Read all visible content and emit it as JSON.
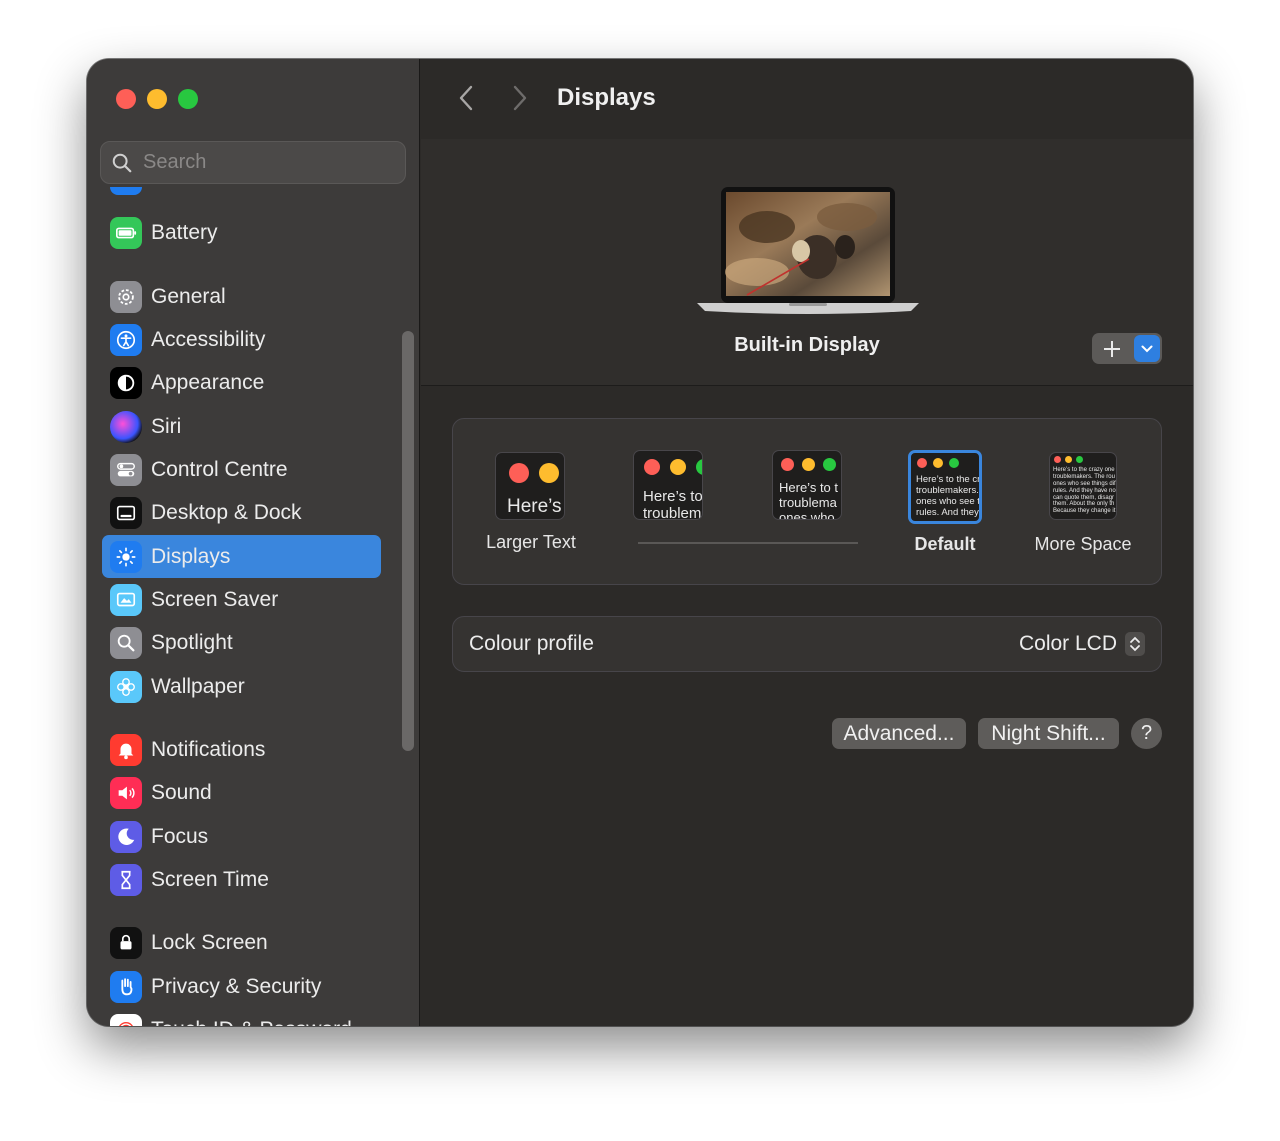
{
  "window": {
    "title": "Displays"
  },
  "sidebar": {
    "search_placeholder": "Search",
    "items": [
      {
        "label": "Battery",
        "icon": "battery-icon",
        "color": "#34c759"
      },
      {
        "label": "General",
        "icon": "gear-icon",
        "color": "#8e8e93"
      },
      {
        "label": "Accessibility",
        "icon": "accessibility-icon",
        "color": "#1f7cf0"
      },
      {
        "label": "Appearance",
        "icon": "appearance-icon",
        "color": "#000000"
      },
      {
        "label": "Siri",
        "icon": "siri-icon",
        "color": "#6a3cc2"
      },
      {
        "label": "Control Centre",
        "icon": "control-centre-icon",
        "color": "#8e8e93"
      },
      {
        "label": "Desktop & Dock",
        "icon": "dock-icon",
        "color": "#111111"
      },
      {
        "label": "Displays",
        "icon": "sun-icon",
        "color": "#1f7cf0"
      },
      {
        "label": "Screen Saver",
        "icon": "screen-saver-icon",
        "color": "#5ac8fa"
      },
      {
        "label": "Spotlight",
        "icon": "magnifier-icon",
        "color": "#8e8e93"
      },
      {
        "label": "Wallpaper",
        "icon": "flower-icon",
        "color": "#5ac8fa"
      },
      {
        "label": "Notifications",
        "icon": "bell-icon",
        "color": "#ff3b30"
      },
      {
        "label": "Sound",
        "icon": "speaker-icon",
        "color": "#ff2d55"
      },
      {
        "label": "Focus",
        "icon": "moon-icon",
        "color": "#5e5ce6"
      },
      {
        "label": "Screen Time",
        "icon": "hourglass-icon",
        "color": "#5e5ce6"
      },
      {
        "label": "Lock Screen",
        "icon": "lock-icon",
        "color": "#111111"
      },
      {
        "label": "Privacy & Security",
        "icon": "hand-icon",
        "color": "#1f7cf0"
      },
      {
        "label": "Touch ID & Password",
        "icon": "fingerprint-icon",
        "color": "#ffffff"
      }
    ],
    "selected": "Displays"
  },
  "display": {
    "name": "Built-in Display"
  },
  "resolution": {
    "options": [
      {
        "label": "Larger Text",
        "sample": "Here’s"
      },
      {
        "label": "",
        "sample": "Here’s to\ntroublem"
      },
      {
        "label": "",
        "sample": "Here’s to t\ntroublema\nones who"
      },
      {
        "label": "Default",
        "sample": "Here’s to the cr\ntroublemakers.\nones who see t\nrules. And they"
      },
      {
        "label": "More Space",
        "sample": "Here’s to the crazy one\ntroublemakers. The rou\nones who see things dif\nrules. And they have no\ncan quote them, disagr\nthem. About the only th\nBecause they change it"
      }
    ],
    "selected": "Default"
  },
  "colour_profile": {
    "label": "Colour profile",
    "value": "Color LCD"
  },
  "buttons": {
    "advanced": "Advanced...",
    "night_shift": "Night Shift...",
    "help": "?"
  },
  "colors": {
    "accent": "#3a86dd",
    "sidebar_bg": "#3d3b3a",
    "main_bg": "#2c2a28"
  }
}
